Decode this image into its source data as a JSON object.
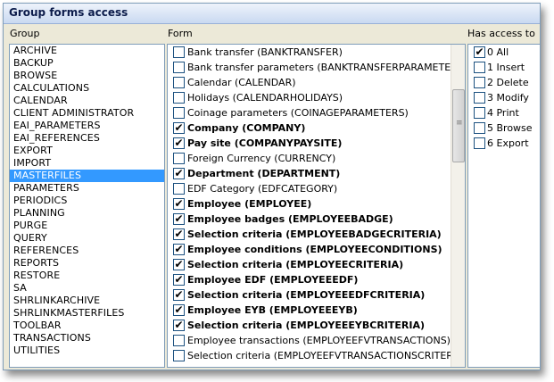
{
  "window": {
    "title": "Group forms access"
  },
  "headers": {
    "group": "Group",
    "form": "Form",
    "access": "Has access to"
  },
  "groups": [
    {
      "label": "ARCHIVE",
      "selected": false
    },
    {
      "label": "BACKUP",
      "selected": false
    },
    {
      "label": "BROWSE",
      "selected": false
    },
    {
      "label": "CALCULATIONS",
      "selected": false
    },
    {
      "label": "CALENDAR",
      "selected": false
    },
    {
      "label": "CLIENT ADMINISTRATOR",
      "selected": false
    },
    {
      "label": "EAI_PARAMETERS",
      "selected": false
    },
    {
      "label": "EAI_REFERENCES",
      "selected": false
    },
    {
      "label": "EXPORT",
      "selected": false
    },
    {
      "label": "IMPORT",
      "selected": false
    },
    {
      "label": "MASTERFILES",
      "selected": true
    },
    {
      "label": "PARAMETERS",
      "selected": false
    },
    {
      "label": "PERIODICS",
      "selected": false
    },
    {
      "label": "PLANNING",
      "selected": false
    },
    {
      "label": "PURGE",
      "selected": false
    },
    {
      "label": "QUERY",
      "selected": false
    },
    {
      "label": "REFERENCES",
      "selected": false
    },
    {
      "label": "REPORTS",
      "selected": false
    },
    {
      "label": "RESTORE",
      "selected": false
    },
    {
      "label": "SA",
      "selected": false
    },
    {
      "label": "SHRLINKARCHIVE",
      "selected": false
    },
    {
      "label": "SHRLINKMASTERFILES",
      "selected": false
    },
    {
      "label": "TOOLBAR",
      "selected": false
    },
    {
      "label": "TRANSACTIONS",
      "selected": false
    },
    {
      "label": "UTILITIES",
      "selected": false
    }
  ],
  "forms": [
    {
      "label": "Bank transfer (BANKTRANSFER)",
      "checked": false
    },
    {
      "label": "Bank transfer parameters (BANKTRANSFERPARAMETERS)",
      "checked": false
    },
    {
      "label": "Calendar (CALENDAR)",
      "checked": false
    },
    {
      "label": "Holidays (CALENDARHOLIDAYS)",
      "checked": false
    },
    {
      "label": "Coinage parameters (COINAGEPARAMETERS)",
      "checked": false
    },
    {
      "label": "Company (COMPANY)",
      "checked": true
    },
    {
      "label": "Pay site (COMPANYPAYSITE)",
      "checked": true
    },
    {
      "label": "Foreign Currency (CURRENCY)",
      "checked": false
    },
    {
      "label": "Department (DEPARTMENT)",
      "checked": true
    },
    {
      "label": "EDF Category (EDFCATEGORY)",
      "checked": false
    },
    {
      "label": "Employee (EMPLOYEE)",
      "checked": true
    },
    {
      "label": "Employee badges (EMPLOYEEBADGE)",
      "checked": true
    },
    {
      "label": "Selection criteria (EMPLOYEEBADGECRITERIA)",
      "checked": true
    },
    {
      "label": "Employee conditions (EMPLOYEECONDITIONS)",
      "checked": true
    },
    {
      "label": "Selection criteria (EMPLOYEECRITERIA)",
      "checked": true
    },
    {
      "label": "Employee EDF (EMPLOYEEEDF)",
      "checked": true
    },
    {
      "label": "Selection criteria (EMPLOYEEEDFCRITERIA)",
      "checked": true
    },
    {
      "label": "Employee EYB (EMPLOYEEEYB)",
      "checked": true
    },
    {
      "label": "Selection criteria (EMPLOYEEEYBCRITERIA)",
      "checked": true
    },
    {
      "label": "Employee transactions (EMPLOYEEFVTRANSACTIONS)",
      "checked": false
    },
    {
      "label": "Selection criteria (EMPLOYEEFVTRANSACTIONSCRITERIA)",
      "checked": false
    }
  ],
  "access": [
    {
      "label": "0 All",
      "checked": true
    },
    {
      "label": "1 Insert",
      "checked": false
    },
    {
      "label": "2 Delete",
      "checked": false
    },
    {
      "label": "3 Modify",
      "checked": false
    },
    {
      "label": "4 Print",
      "checked": false
    },
    {
      "label": "5 Browse",
      "checked": false
    },
    {
      "label": "6 Export",
      "checked": false
    }
  ],
  "icons": {
    "check": "✔",
    "scroll_grip": "≡"
  }
}
